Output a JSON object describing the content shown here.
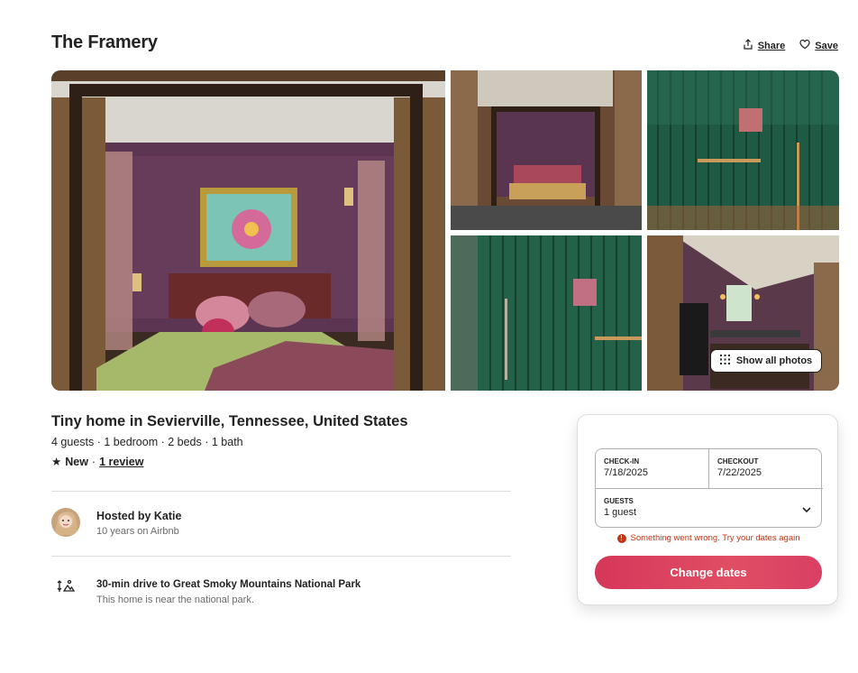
{
  "listing": {
    "title": "The Framery",
    "share_label": "Share",
    "save_label": "Save",
    "show_all_photos": "Show all photos",
    "subtitle": "Tiny home in Sevierville, Tennessee, United States",
    "details": "4 guests · 1 bedroom · 2 beds · 1 bath",
    "rating_star": "★",
    "rating_new": "New",
    "rating_sep": "·",
    "rating_review": "1 review"
  },
  "host": {
    "name": "Hosted by Katie",
    "meta": "10 years on Airbnb"
  },
  "highlight": {
    "title": "30-min drive to Great Smoky Mountains National Park",
    "subtitle": "This home is near the national park."
  },
  "booking": {
    "checkin_label": "CHECK-IN",
    "checkin_value": "7/18/2025",
    "checkout_label": "CHECKOUT",
    "checkout_value": "7/22/2025",
    "guests_label": "GUESTS",
    "guests_value": "1 guest",
    "error_icon": "!",
    "error_text": "Something went wrong. Try your dates again",
    "cta_label": "Change dates"
  },
  "icons": {
    "share": "share-icon",
    "save": "heart-icon",
    "grid": "grid-icon",
    "chevron": "chevron-down-icon",
    "error": "error-icon",
    "highlight": "mountain-drive-icon"
  },
  "colors": {
    "brand": "#e0475f",
    "error": "#c13515",
    "text": "#222222",
    "muted": "#6a6a6a"
  }
}
